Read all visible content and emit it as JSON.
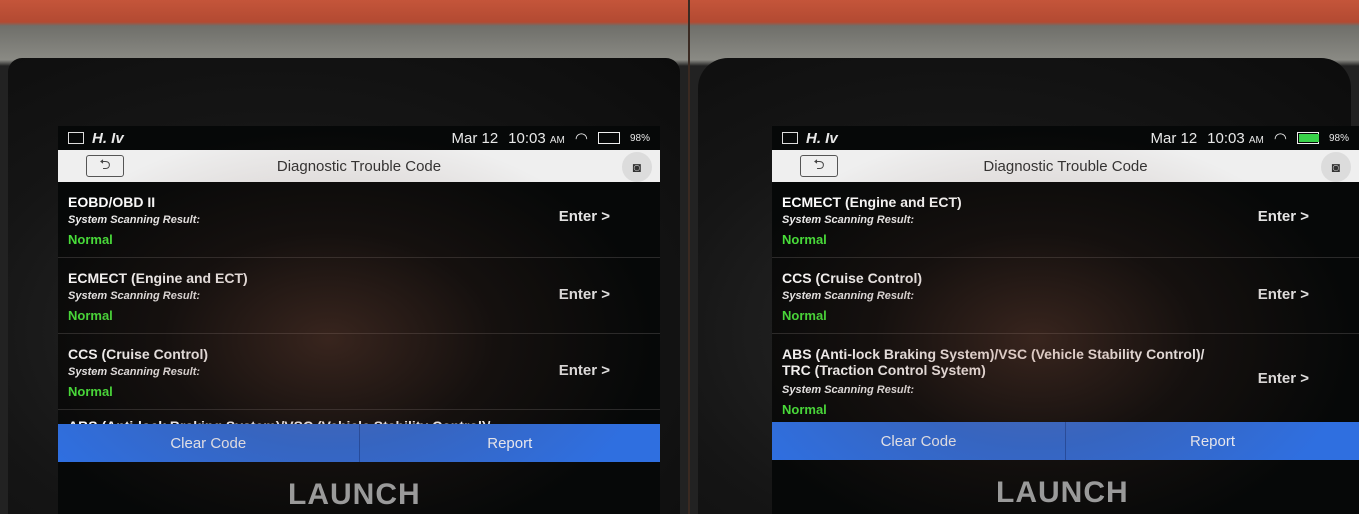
{
  "colors": {
    "normal_status": "#47e23a",
    "button_blue": "#2f6fe0",
    "title_bar_bg": "#efefef",
    "battery_green": "#39d34a"
  },
  "brand": "LAUNCH",
  "left": {
    "status": {
      "left_text": "H. Iv",
      "date": "Mar 12",
      "time": "10:03",
      "am": "AM",
      "battery": "98%",
      "battery_level": 0
    },
    "title": "Diagnostic Trouble Code",
    "items": [
      {
        "name": "EOBD/OBD II",
        "label": "System Scanning Result:",
        "value": "Normal",
        "action": "Enter >"
      },
      {
        "name": "ECMECT (Engine and ECT)",
        "label": "System Scanning Result:",
        "value": "Normal",
        "action": "Enter >"
      },
      {
        "name": "CCS (Cruise Control)",
        "label": "System Scanning Result:",
        "value": "Normal",
        "action": "Enter >"
      },
      {
        "name": "ABS (Anti-lock Braking System)/VSC (Vehicle Stability Control)/"
      }
    ],
    "buttons": {
      "clear": "Clear Code",
      "report": "Report"
    }
  },
  "right": {
    "status": {
      "left_text": "H. Iv",
      "date": "Mar 12",
      "time": "10:03",
      "am": "AM",
      "battery": "98%",
      "battery_level": 0.98
    },
    "title": "Diagnostic Trouble Code",
    "items": [
      {
        "name": "ECMECT (Engine and ECT)",
        "label": "System Scanning Result:",
        "value": "Normal",
        "action": "Enter >"
      },
      {
        "name": "CCS (Cruise Control)",
        "label": "System Scanning Result:",
        "value": "Normal",
        "action": "Enter >"
      },
      {
        "name": "ABS (Anti-lock Braking System)/VSC (Vehicle Stability Control)/ TRC (Traction Control System)",
        "label": "System Scanning Result:",
        "value": "Normal",
        "action": "Enter >"
      }
    ],
    "buttons": {
      "clear": "Clear Code",
      "report": "Report"
    }
  }
}
